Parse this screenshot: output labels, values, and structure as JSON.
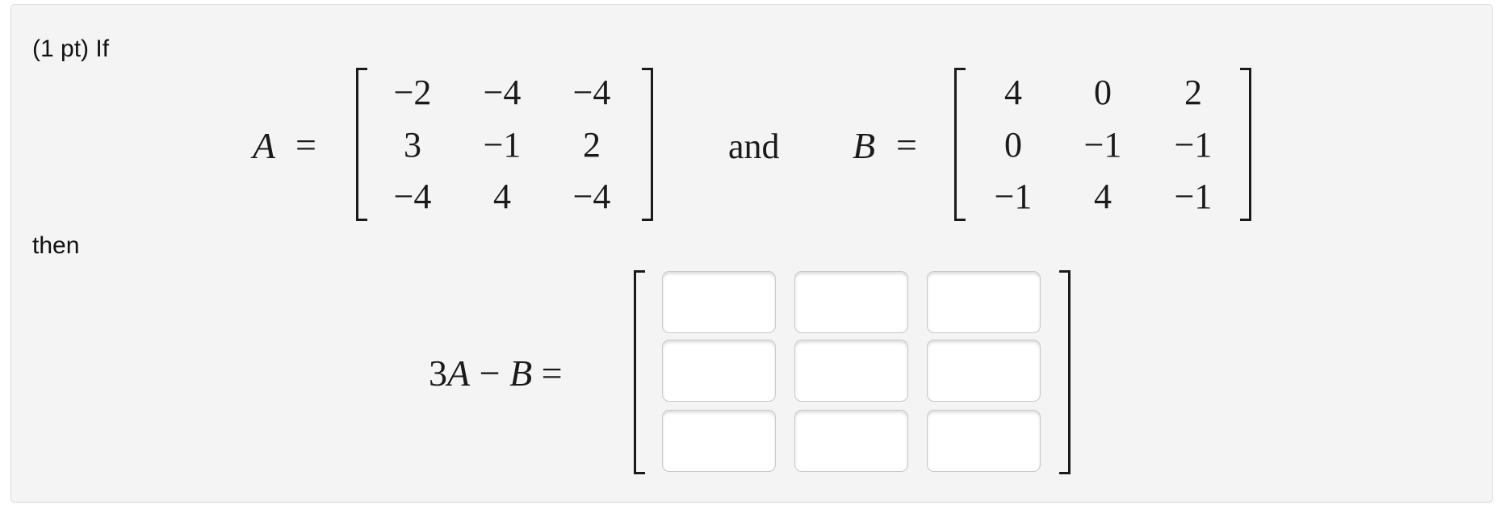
{
  "problem": {
    "intro": "(1 pt) If",
    "connector": "then",
    "and_word": "and",
    "matrix_A": {
      "label": "A",
      "equals": "=",
      "rows": [
        [
          "−2",
          "−4",
          "−4"
        ],
        [
          "3",
          "−1",
          "2"
        ],
        [
          "−4",
          "4",
          "−4"
        ]
      ]
    },
    "matrix_B": {
      "label": "B",
      "equals": "=",
      "rows": [
        [
          "4",
          "0",
          "2"
        ],
        [
          "0",
          "−1",
          "−1"
        ],
        [
          "−1",
          "4",
          "−1"
        ]
      ]
    },
    "answer": {
      "expression_lhs": "3",
      "expression_A": "A",
      "expression_minus": "−",
      "expression_B": "B",
      "equals": "=",
      "inputs": [
        [
          "",
          "",
          ""
        ],
        [
          "",
          "",
          ""
        ],
        [
          "",
          "",
          ""
        ]
      ]
    }
  },
  "colors": {
    "panel_background": "#f4f4f4",
    "panel_border": "#dcdcdc",
    "input_border": "#c8c8c8",
    "text": "#111111"
  }
}
